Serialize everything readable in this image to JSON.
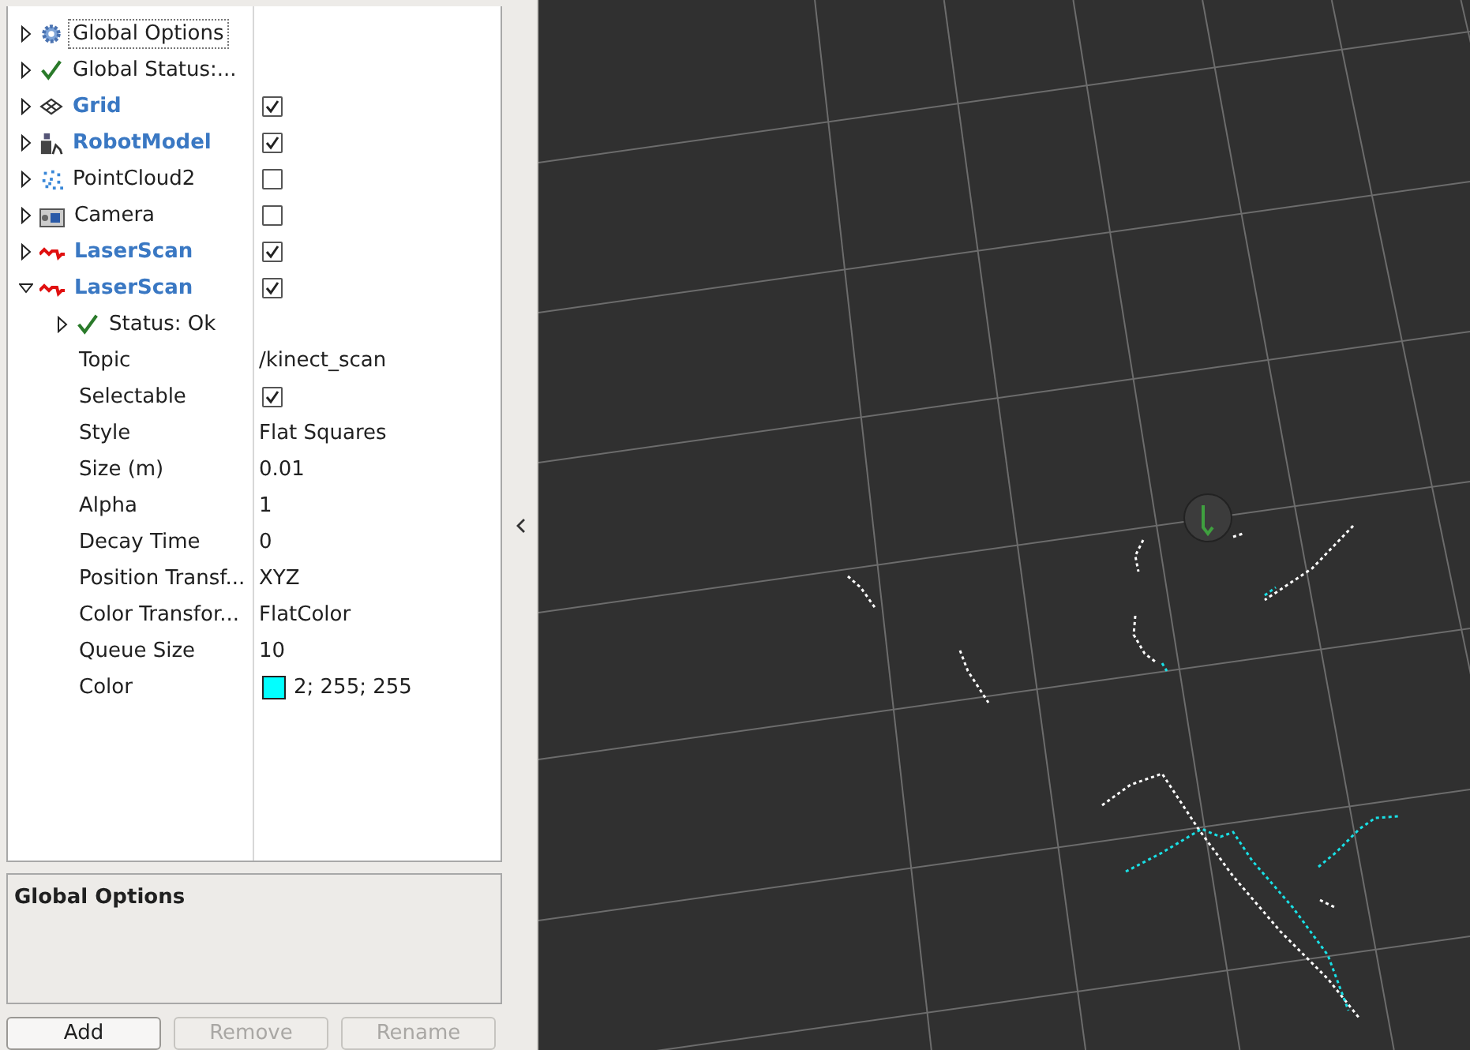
{
  "displays": [
    {
      "kind": "options",
      "label": "Global Options",
      "expanded": false,
      "selected": true
    },
    {
      "kind": "status",
      "label": "Global Status:...",
      "expanded": false,
      "selected": false
    },
    {
      "kind": "grid",
      "label": "Grid",
      "expanded": false,
      "selected": false,
      "checked": true
    },
    {
      "kind": "robot_model",
      "label": "RobotModel",
      "expanded": false,
      "selected": false,
      "checked": true
    },
    {
      "kind": "point_cloud",
      "label": "PointCloud2",
      "expanded": false,
      "selected": false,
      "checked": false
    },
    {
      "kind": "camera",
      "label": "Camera",
      "expanded": false,
      "selected": false,
      "checked": false
    },
    {
      "kind": "laser_scan",
      "label": "LaserScan",
      "expanded": false,
      "selected": false,
      "checked": true
    },
    {
      "kind": "laser_scan",
      "label": "LaserScan",
      "expanded": true,
      "selected": false,
      "checked": true,
      "children": [
        {
          "kind": "status",
          "label": "Status: Ok",
          "expanded": false
        },
        {
          "kind": "text",
          "label": "Topic",
          "value": "/kinect_scan"
        },
        {
          "kind": "checkbox",
          "label": "Selectable",
          "checked": true
        },
        {
          "kind": "text",
          "label": "Style",
          "value": "Flat Squares"
        },
        {
          "kind": "text",
          "label": "Size (m)",
          "value": "0.01"
        },
        {
          "kind": "text",
          "label": "Alpha",
          "value": "1"
        },
        {
          "kind": "text",
          "label": "Decay Time",
          "value": "0"
        },
        {
          "kind": "text",
          "label": "Position Transf...",
          "value": "XYZ"
        },
        {
          "kind": "text",
          "label": "Color Transfor...",
          "value": "FlatColor"
        },
        {
          "kind": "text",
          "label": "Queue Size",
          "value": "10"
        },
        {
          "kind": "color",
          "label": "Color",
          "value": "2; 255; 255",
          "color": "#02ffff"
        }
      ]
    }
  ],
  "description": {
    "title": "Global Options"
  },
  "buttons": [
    {
      "label": "Add",
      "disabled": false
    },
    {
      "label": "Remove",
      "disabled": true
    },
    {
      "label": "Rename",
      "disabled": true
    }
  ]
}
